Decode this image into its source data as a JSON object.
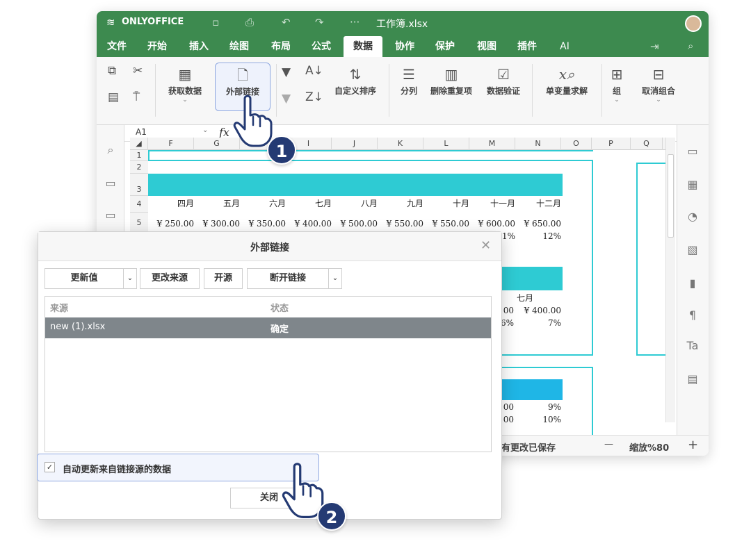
{
  "titlebar": {
    "brand": "ONLYOFFICE",
    "filename": "工作簿.xlsx",
    "more": "···"
  },
  "menu": {
    "items": [
      "文件",
      "开始",
      "插入",
      "绘图",
      "布局",
      "公式",
      "数据",
      "协作",
      "保护",
      "视图",
      "插件",
      "AI"
    ],
    "active": "数据"
  },
  "toolbar": {
    "get_data": "获取数据",
    "external_links": "外部链接",
    "custom_sort": "自定义排序",
    "text_to_columns": "分列",
    "remove_duplicates": "删除重复项",
    "data_validation": "数据验证",
    "goal_seek": "单变量求解",
    "group": "组",
    "ungroup": "取消组合"
  },
  "formula_bar": {
    "cell_ref": "A1",
    "fx": "fx"
  },
  "sheet": {
    "columns": [
      "F",
      "G",
      "H",
      "I",
      "J",
      "K",
      "L",
      "M",
      "N",
      "O",
      "P",
      "Q"
    ],
    "rows": [
      "1",
      "2",
      "3",
      "4",
      "5"
    ],
    "months": [
      "四月",
      "五月",
      "六月",
      "七月",
      "八月",
      "九月",
      "十月",
      "十一月",
      "十二月"
    ],
    "values": [
      "¥ 250.00",
      "¥ 300.00",
      "¥ 350.00",
      "¥ 400.00",
      "¥ 500.00",
      "¥ 550.00",
      "¥ 550.00",
      "¥ 600.00",
      "¥ 650.00"
    ],
    "partial_row6": [
      "1%",
      "12%"
    ],
    "block2": {
      "month": "七月",
      "value_prefix": "00",
      "value": "¥ 400.00",
      "pct_prefix": "6%",
      "pct": "7%"
    },
    "block3": {
      "r1_prefix": "00",
      "r1": "9%",
      "r2_prefix": "00",
      "r2": "10%"
    }
  },
  "status": {
    "saved": "有更改已保存",
    "zoom": "缩放%80",
    "minus": "—",
    "plus": "+"
  },
  "dialog": {
    "title": "外部链接",
    "buttons": {
      "update_values": "更新值",
      "change_source": "更改来源",
      "open_source": "开源",
      "break_link": "断开链接",
      "close": "关闭"
    },
    "list": {
      "headers": {
        "source": "来源",
        "status": "状态"
      },
      "rows": [
        {
          "source": "new (1).xlsx",
          "status": "确定"
        }
      ]
    },
    "auto_update": {
      "label": "自动更新来自链接源的数据",
      "checked": true
    }
  },
  "callouts": [
    "1",
    "2"
  ],
  "colors": {
    "brand_green": "#3d8a4f",
    "teal": "#2ecbd3",
    "badge_navy": "#243a73",
    "highlight_border": "#8fa8e0"
  }
}
